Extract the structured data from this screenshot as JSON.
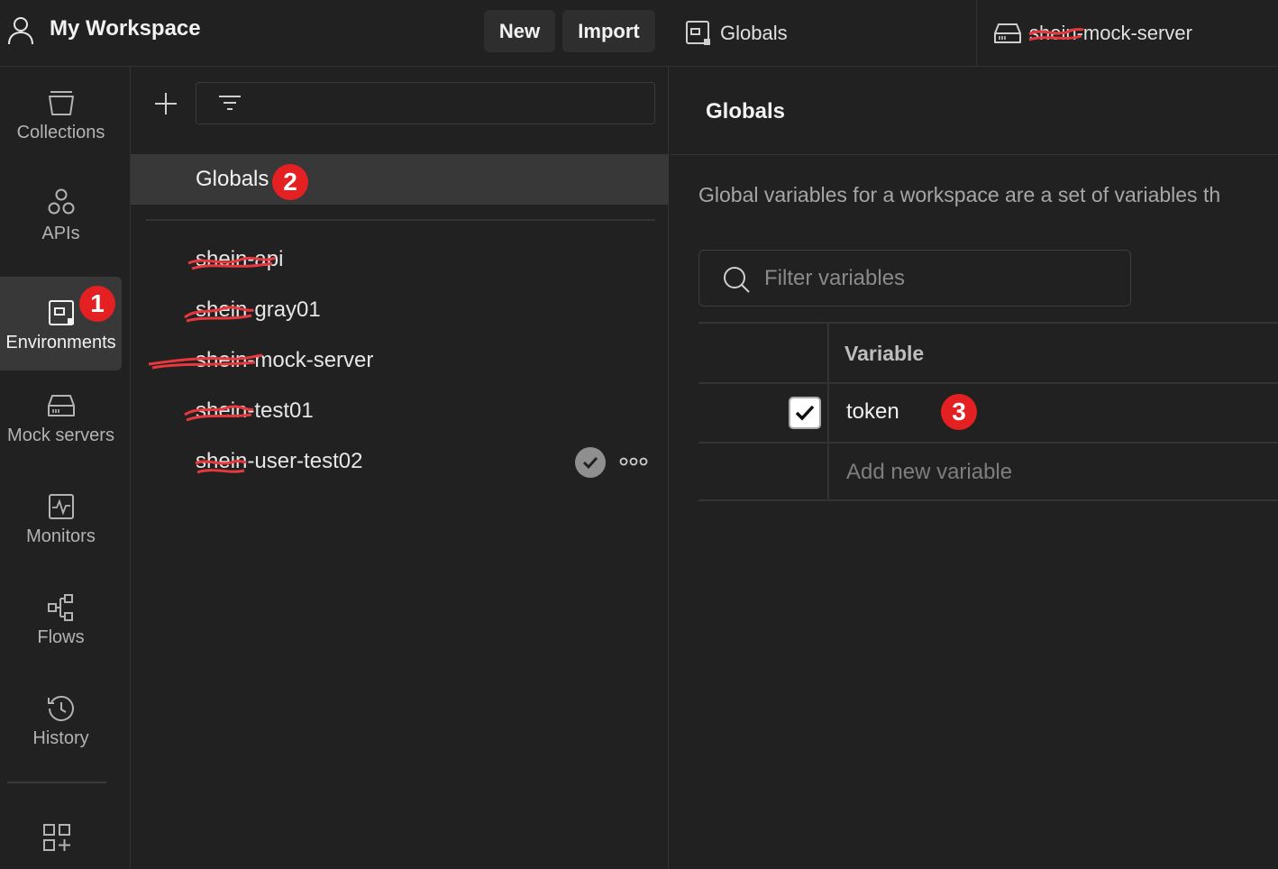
{
  "header": {
    "workspace_title": "My Workspace",
    "new_label": "New",
    "import_label": "Import"
  },
  "sidebar": {
    "items": [
      {
        "label": "Collections",
        "icon": "collections-icon"
      },
      {
        "label": "APIs",
        "icon": "apis-icon"
      },
      {
        "label": "Environments",
        "icon": "environments-icon",
        "active": true
      },
      {
        "label": "Mock servers",
        "icon": "mock-servers-icon"
      },
      {
        "label": "Monitors",
        "icon": "monitors-icon"
      },
      {
        "label": "Flows",
        "icon": "flows-icon"
      },
      {
        "label": "History",
        "icon": "history-icon"
      }
    ]
  },
  "environments": {
    "globals_label": "Globals",
    "items": [
      {
        "label": "shein-api"
      },
      {
        "label": "shein-gray01"
      },
      {
        "label": "shein-mock-server"
      },
      {
        "label": "shein-test01"
      },
      {
        "label": "shein-user-test02",
        "active": true
      }
    ]
  },
  "tabs": [
    {
      "label": "Globals",
      "icon": "environment-icon"
    },
    {
      "label": "shein-mock-server",
      "icon": "mock-server-icon"
    }
  ],
  "content": {
    "title": "Globals",
    "description": "Global variables for a workspace are a set of variables th",
    "filter_placeholder": "Filter variables",
    "column_variable": "Variable",
    "variables": [
      {
        "name": "token",
        "enabled": true
      }
    ],
    "add_new_placeholder": "Add new variable"
  },
  "annotations": {
    "badge1": "1",
    "badge2": "2",
    "badge3": "3",
    "color": "#e42022"
  },
  "redaction_color": "#e8383d"
}
